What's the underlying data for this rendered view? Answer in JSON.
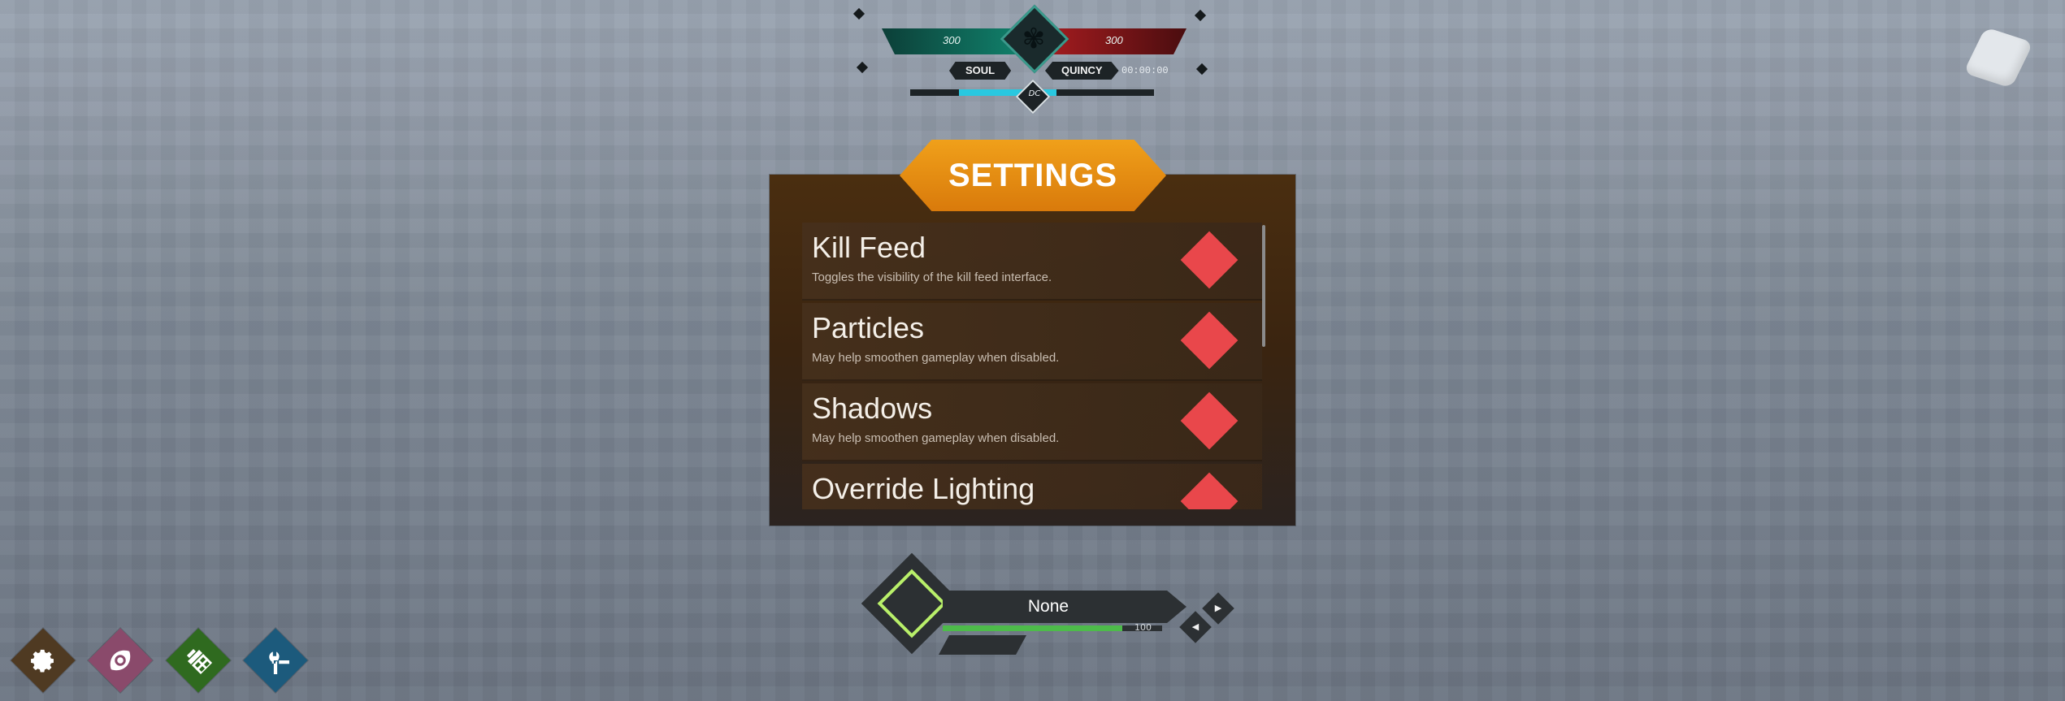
{
  "hud": {
    "team_left_value": "300",
    "team_right_value": "300",
    "team_left_label": "SOUL",
    "team_right_label": "QUINCY",
    "timer": "00:00:00",
    "dc_label": "DC",
    "left_color": "#118c74",
    "right_color": "#b31e22",
    "sub_bar_color": "#29c8e0"
  },
  "settings": {
    "title": "SETTINGS",
    "accent": "#e9474b",
    "items": [
      {
        "title": "Kill Feed",
        "desc": "Toggles the visibility of the kill feed interface."
      },
      {
        "title": "Particles",
        "desc": "May help smoothen gameplay when disabled."
      },
      {
        "title": "Shadows",
        "desc": "May help smoothen gameplay when disabled."
      },
      {
        "title": "Override Lighting",
        "desc": ""
      }
    ]
  },
  "selector": {
    "name": "None",
    "value": "100",
    "health_fraction": 0.82,
    "health_color": "#4dbb4a",
    "ring_color": "#b9f06a"
  },
  "toolbar": [
    {
      "icon": "gear-icon",
      "color": "#4f3a22"
    },
    {
      "icon": "eye-icon",
      "color": "#8a4a6b"
    },
    {
      "icon": "inventory-icon",
      "color": "#2f6a1f"
    },
    {
      "icon": "tools-icon",
      "color": "#1c5a7c"
    }
  ]
}
